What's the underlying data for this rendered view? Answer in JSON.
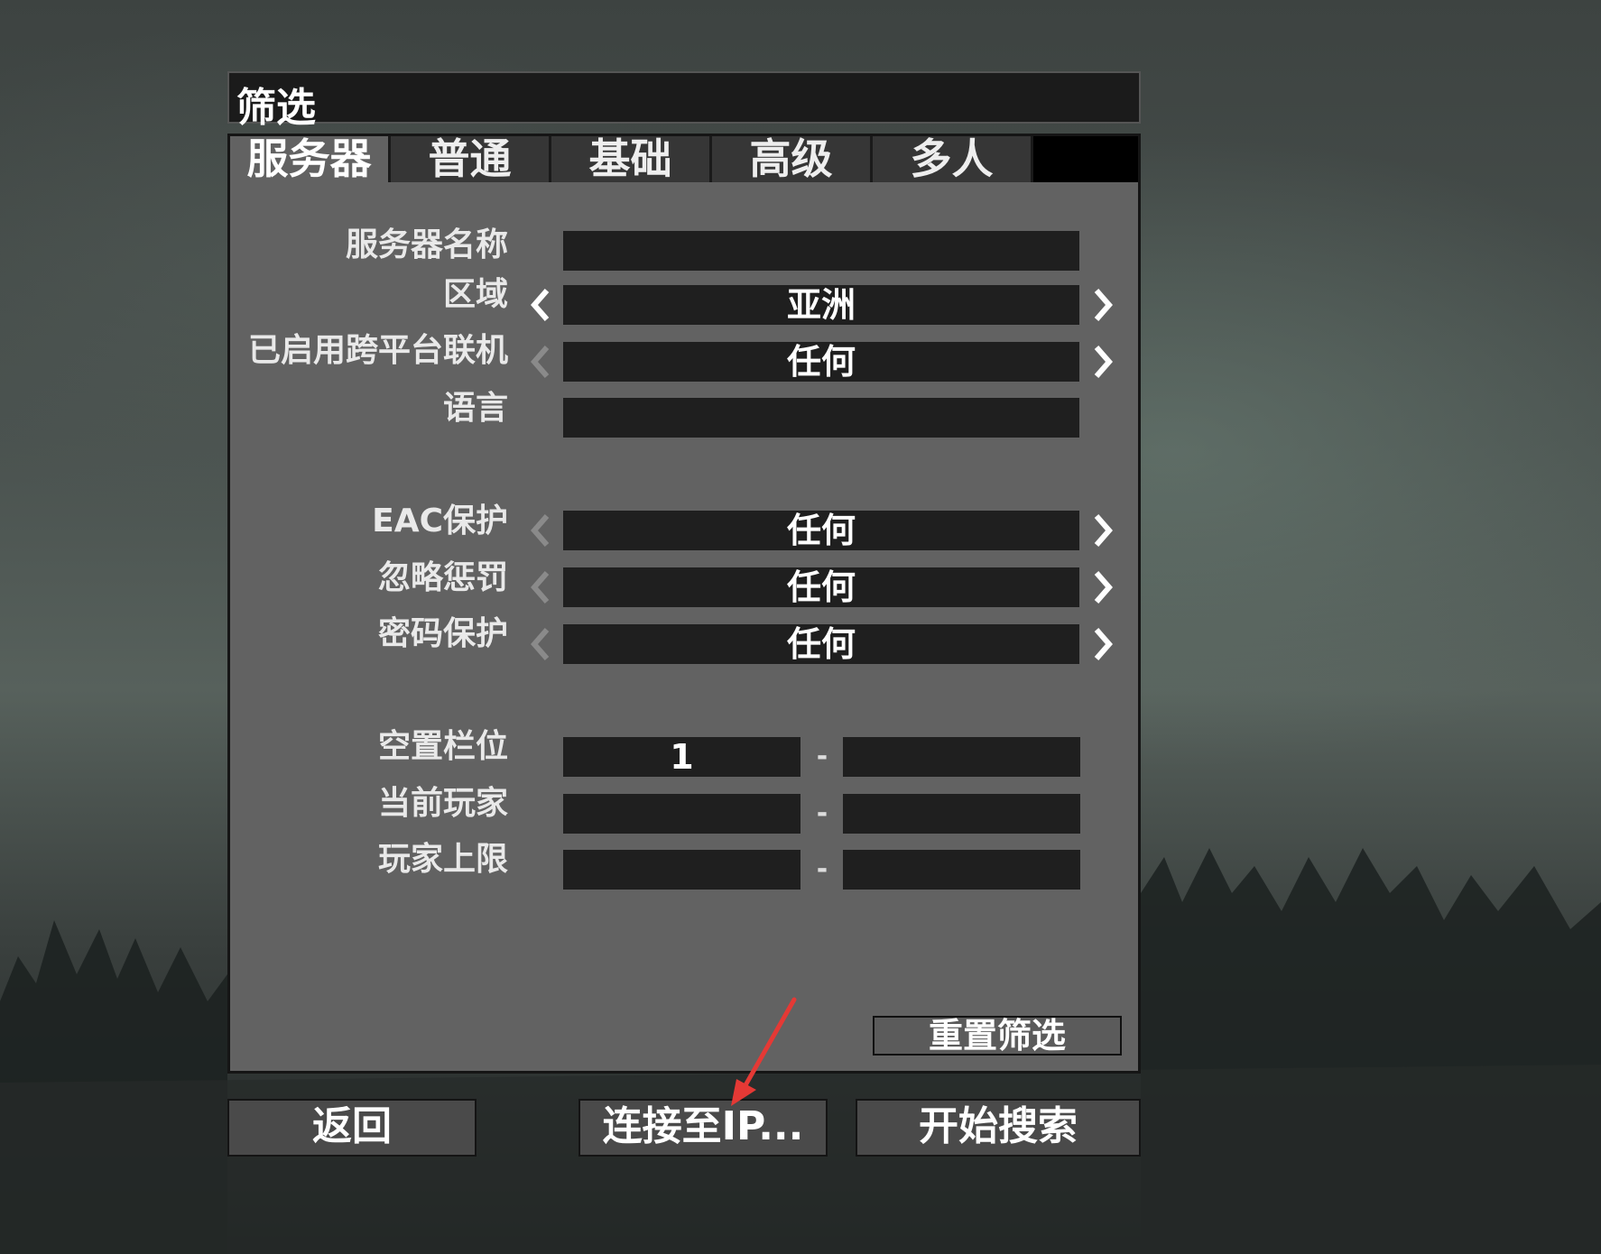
{
  "dialog": {
    "title": "筛选"
  },
  "tabs": [
    {
      "label": "服务器",
      "active": true
    },
    {
      "label": "普通",
      "active": false
    },
    {
      "label": "基础",
      "active": false
    },
    {
      "label": "高级",
      "active": false
    },
    {
      "label": "多人",
      "active": false
    }
  ],
  "fields": {
    "server_name": {
      "label": "服务器名称",
      "value": ""
    },
    "region": {
      "label": "区域",
      "value": "亚洲"
    },
    "crossplay": {
      "label": "已启用跨平台联机",
      "value": "任何"
    },
    "language": {
      "label": "语言",
      "value": ""
    },
    "eac": {
      "label": "EAC保护",
      "value": "任何"
    },
    "ignore_penalty": {
      "label": "忽略惩罚",
      "value": "任何"
    },
    "password": {
      "label": "密码保护",
      "value": "任何"
    },
    "free_slots": {
      "label": "空置栏位",
      "min": "1",
      "max": ""
    },
    "current_players": {
      "label": "当前玩家",
      "min": "",
      "max": ""
    },
    "max_players": {
      "label": "玩家上限",
      "min": "",
      "max": ""
    },
    "range_separator": "-"
  },
  "buttons": {
    "reset": "重置筛选",
    "back": "返回",
    "connect_ip": "连接至IP...",
    "search": "开始搜索"
  },
  "colors": {
    "panel_bg": "#626262",
    "field_bg": "#1f1f1f",
    "annotation_arrow": "#e53935"
  }
}
